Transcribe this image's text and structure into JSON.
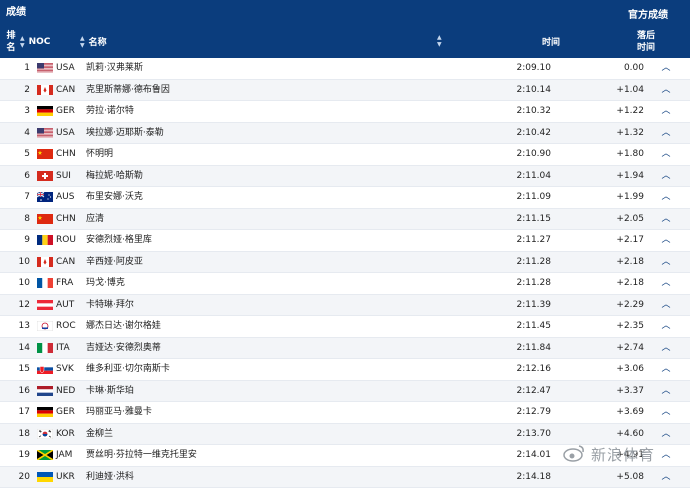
{
  "header": {
    "title": "成绩",
    "official": "官方成绩",
    "col_rank": "排名",
    "col_noc": "NOC",
    "col_name": "名称",
    "col_time": "时间",
    "col_behind": "落后时间"
  },
  "rows": [
    {
      "rank": "1",
      "noc": "USA",
      "name": "凯莉·汉弗莱斯",
      "time": "2:09.10",
      "behind": "0.00"
    },
    {
      "rank": "2",
      "noc": "CAN",
      "name": "克里斯蒂娜·德布鲁因",
      "time": "2:10.14",
      "behind": "+1.04"
    },
    {
      "rank": "3",
      "noc": "GER",
      "name": "劳拉·诺尔特",
      "time": "2:10.32",
      "behind": "+1.22"
    },
    {
      "rank": "4",
      "noc": "USA",
      "name": "埃拉娜·迈耶斯·泰勒",
      "time": "2:10.42",
      "behind": "+1.32"
    },
    {
      "rank": "5",
      "noc": "CHN",
      "name": "怀明明",
      "time": "2:10.90",
      "behind": "+1.80"
    },
    {
      "rank": "6",
      "noc": "SUI",
      "name": "梅拉妮·哈斯勒",
      "time": "2:11.04",
      "behind": "+1.94"
    },
    {
      "rank": "7",
      "noc": "AUS",
      "name": "布里安娜·沃克",
      "time": "2:11.09",
      "behind": "+1.99"
    },
    {
      "rank": "8",
      "noc": "CHN",
      "name": "应清",
      "time": "2:11.15",
      "behind": "+2.05"
    },
    {
      "rank": "9",
      "noc": "ROU",
      "name": "安德烈娅·格里库",
      "time": "2:11.27",
      "behind": "+2.17"
    },
    {
      "rank": "10",
      "noc": "CAN",
      "name": "辛西娅·阿皮亚",
      "time": "2:11.28",
      "behind": "+2.18"
    },
    {
      "rank": "10",
      "noc": "FRA",
      "name": "玛戈·博克",
      "time": "2:11.28",
      "behind": "+2.18"
    },
    {
      "rank": "12",
      "noc": "AUT",
      "name": "卡特琳·拜尔",
      "time": "2:11.39",
      "behind": "+2.29"
    },
    {
      "rank": "13",
      "noc": "ROC",
      "name": "娜杰日达·谢尔格娃",
      "time": "2:11.45",
      "behind": "+2.35"
    },
    {
      "rank": "14",
      "noc": "ITA",
      "name": "吉娅达·安德烈奥蒂",
      "time": "2:11.84",
      "behind": "+2.74"
    },
    {
      "rank": "15",
      "noc": "SVK",
      "name": "维多利亚·切尔南斯卡",
      "time": "2:12.16",
      "behind": "+3.06"
    },
    {
      "rank": "16",
      "noc": "NED",
      "name": "卡琳·斯华珀",
      "time": "2:12.47",
      "behind": "+3.37"
    },
    {
      "rank": "17",
      "noc": "GER",
      "name": "玛丽亚马·雅曼卡",
      "time": "2:12.79",
      "behind": "+3.69"
    },
    {
      "rank": "18",
      "noc": "KOR",
      "name": "金柳兰",
      "time": "2:13.70",
      "behind": "+4.60"
    },
    {
      "rank": "19",
      "noc": "JAM",
      "name": "贾丝明·芬拉特一维克托里安",
      "time": "2:14.01",
      "behind": "+4.91"
    },
    {
      "rank": "20",
      "noc": "UKR",
      "name": "利迪娅·洪科",
      "time": "2:14.18",
      "behind": "+5.08"
    }
  ],
  "watermark": "新浪体育"
}
